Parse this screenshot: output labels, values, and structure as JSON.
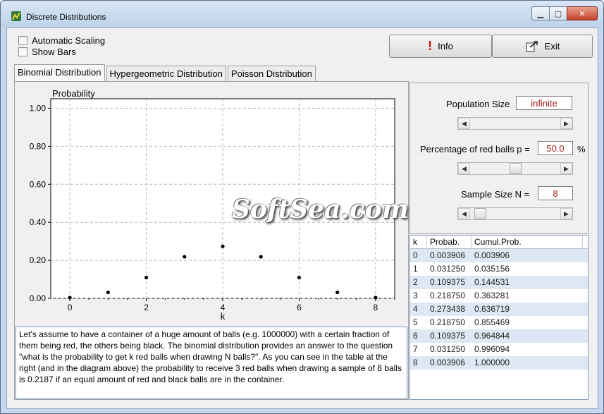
{
  "window": {
    "title": "Discrete Distributions"
  },
  "options": {
    "automatic_scaling": "Automatic Scaling",
    "show_bars": "Show Bars"
  },
  "buttons": {
    "info": "Info",
    "exit": "Exit"
  },
  "tabs": [
    {
      "label": "Binomial Distribution",
      "active": true
    },
    {
      "label": "Hypergeometric Distribution",
      "active": false
    },
    {
      "label": "Poisson Distribution",
      "active": false
    }
  ],
  "params": {
    "population_label": "Population Size",
    "population_value": "infinite",
    "percentage_label": "Percentage of red balls p =",
    "percentage_value": "50.0",
    "percentage_unit": "%",
    "sample_label": "Sample Size N =",
    "sample_value": "8",
    "percentage_slider": 0.5,
    "sample_slider": 0.05
  },
  "table": {
    "headers": [
      "k",
      "Probab.",
      "Cumul.Prob."
    ],
    "rows": [
      [
        "0",
        "0.003906",
        "0.003906"
      ],
      [
        "1",
        "0.031250",
        "0.035156"
      ],
      [
        "2",
        "0.109375",
        "0.144531"
      ],
      [
        "3",
        "0.218750",
        "0.363281"
      ],
      [
        "4",
        "0.273438",
        "0.636719"
      ],
      [
        "5",
        "0.218750",
        "0.855469"
      ],
      [
        "6",
        "0.109375",
        "0.964844"
      ],
      [
        "7",
        "0.031250",
        "0.996094"
      ],
      [
        "8",
        "0.003906",
        "1.000000"
      ]
    ]
  },
  "description": "Let's assume to have a container of a huge amount of balls (e.g. 1000000) with a certain fraction of them being red, the others being black. The binomial distribution provides an answer to the question \"what is the probability to get k red balls when drawing N balls?\". As you can see in the table at the right (and in the diagram above) the probability to receive 3 red balls when drawing a sample of 8 balls is 0.2187 if an equal amount of red and black balls are in the container.",
  "watermark": "SoftSea.com",
  "chart_data": {
    "type": "scatter",
    "title": "",
    "xlabel": "k",
    "ylabel": "Probability",
    "x": [
      0,
      1,
      2,
      3,
      4,
      5,
      6,
      7,
      8
    ],
    "y": [
      0.003906,
      0.03125,
      0.109375,
      0.21875,
      0.273438,
      0.21875,
      0.109375,
      0.03125,
      0.003906
    ],
    "xlim": [
      -0.5,
      8.5
    ],
    "ylim": [
      0,
      1.05
    ],
    "xticks": [
      "0",
      "2",
      "4",
      "6",
      "8"
    ],
    "yticks": [
      "0.00",
      "0.20",
      "0.40",
      "0.60",
      "0.80",
      "1.00"
    ],
    "grid": true
  }
}
